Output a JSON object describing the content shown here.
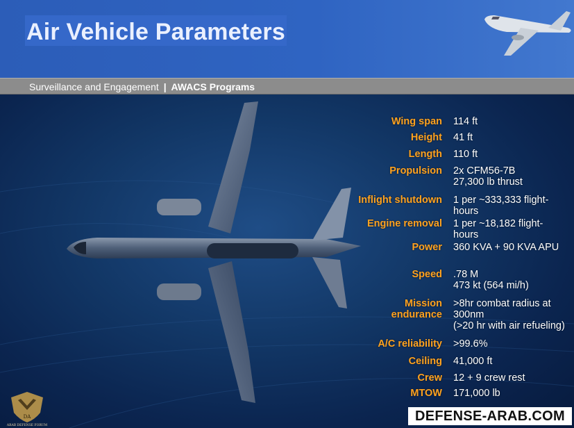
{
  "title": "Air Vehicle Parameters",
  "subbar": {
    "section": "Surveillance and Engagement",
    "separator": "|",
    "program": "AWACS Programs"
  },
  "parameters": [
    {
      "label": "Wing span",
      "value": "114 ft"
    },
    {
      "label": "Height",
      "value": "41 ft"
    },
    {
      "label": "Length",
      "value": "110 ft"
    },
    {
      "label": "Propulsion",
      "value": "2x CFM56-7B\n27,300 lb thrust"
    },
    {
      "label": "Inflight shutdown",
      "value": "1 per ~333,333 flight-\nhours"
    },
    {
      "label": "Engine removal",
      "value": "1 per ~18,182 flight-\nhours"
    },
    {
      "label": "Power",
      "value": "360 KVA + 90 KVA APU"
    },
    {
      "label": "Speed",
      "value": ".78 M\n473 kt (564 mi/h)"
    },
    {
      "label": "Mission\nendurance",
      "value": ">8hr combat radius at\n300nm\n(>20 hr with air refueling)"
    },
    {
      "label": "A/C reliability",
      "value": ">99.6%"
    },
    {
      "label": "Ceiling",
      "value": "41,000 ft"
    },
    {
      "label": "Crew",
      "value": "12 + 9 crew rest"
    },
    {
      "label": "MTOW",
      "value": "171,000 lb"
    }
  ],
  "watermark": "DEFENSE-ARAB.COM",
  "logo_text": {
    "initials": "DA",
    "name": "ARAB DEFENSE FORUM"
  },
  "colors": {
    "label": "#ffa21f",
    "value": "#ffffff",
    "header": "#2f64c2",
    "subbar": "#8c8c8c"
  },
  "icons": {
    "header_plane": "aircraft-icon",
    "main_plane": "aircraft-topview-icon",
    "logo": "eagle-shield-icon"
  }
}
